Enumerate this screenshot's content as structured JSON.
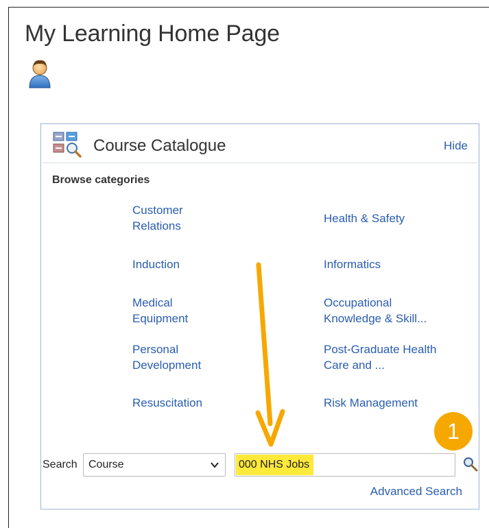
{
  "page": {
    "title": "My Learning Home Page"
  },
  "catalog": {
    "title": "Course Catalogue",
    "hide_label": "Hide",
    "browse_label": "Browse categories",
    "categories": [
      {
        "label_line1": "Customer",
        "label_line2": "Relations"
      },
      {
        "label_line1": "Health & Safety",
        "label_line2": ""
      },
      {
        "label_line1": "Induction",
        "label_line2": ""
      },
      {
        "label_line1": "Informatics",
        "label_line2": ""
      },
      {
        "label_line1": "Medical",
        "label_line2": "Equipment"
      },
      {
        "label_line1": "Occupational",
        "label_line2": "Knowledge & Skill..."
      },
      {
        "label_line1": "Personal",
        "label_line2": "Development"
      },
      {
        "label_line1": "Post-Graduate Health",
        "label_line2": "Care and ..."
      },
      {
        "label_line1": "Resuscitation",
        "label_line2": ""
      },
      {
        "label_line1": "Risk Management",
        "label_line2": ""
      }
    ],
    "search": {
      "label": "Search",
      "type_selected": "Course",
      "query_value": "000 NHS Jobs"
    },
    "advanced_search_label": "Advanced Search"
  },
  "annotation": {
    "badge_number": "1",
    "highlight_color": "#ffe93b",
    "arrow_color": "#f6a800"
  },
  "colors": {
    "link": "#2a5db0",
    "panel_border": "#9db4d6"
  }
}
